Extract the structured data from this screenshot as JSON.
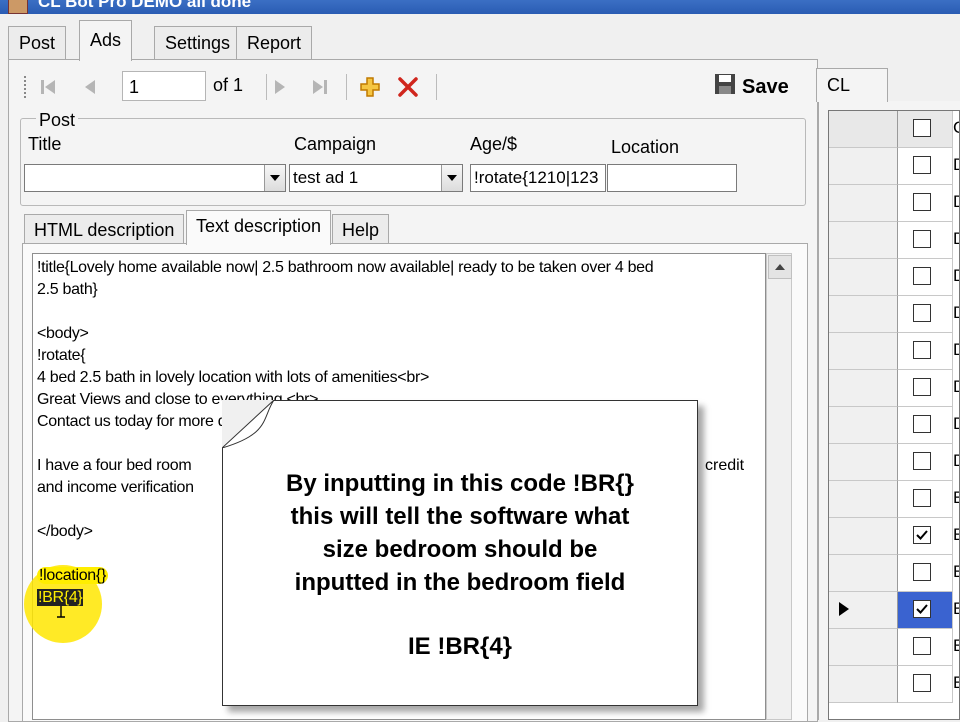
{
  "window": {
    "title": "CL Bot Pro DEMO all done"
  },
  "main_tabs": [
    {
      "label": "Post",
      "active": false
    },
    {
      "label": "Ads",
      "active": true
    },
    {
      "label": "Settings",
      "active": false
    },
    {
      "label": "Report",
      "active": false
    }
  ],
  "toolbar": {
    "current_record": "1",
    "of_count": "of 1",
    "save_label": "Save",
    "icons": [
      "move-first-icon",
      "move-previous-icon",
      "move-next-icon",
      "move-last-icon",
      "add-icon",
      "delete-icon",
      "save-disk-icon"
    ]
  },
  "post_group": {
    "legend": "Post",
    "title_label": "Title",
    "title_value": "",
    "campaign_label": "Campaign",
    "campaign_value": "test ad 1",
    "age_label": "Age/$",
    "age_value": "!rotate{1210|123",
    "location_label": "Location",
    "location_value": ""
  },
  "desc_tabs": [
    {
      "label": "HTML description",
      "active": false
    },
    {
      "label": "Text description",
      "active": true
    },
    {
      "label": "Help",
      "active": false
    }
  ],
  "editor": {
    "lines": [
      "!title{Lovely home available now| 2.5 bathroom now available| ready to be taken over 4 bed",
      "2.5 bath}",
      "",
      "<body>",
      "!rotate{",
      "4 bed 2.5 bath in lovely location with lots of amenities<br>",
      "Great Views and close to everything <br>",
      "Contact us today for more d",
      "",
      "I have a four bed room",
      "and income verification",
      "",
      "</body>",
      "",
      "!location{}",
      "!BR{4}"
    ],
    "peek_right_line10": "credit"
  },
  "callout": {
    "message_lines": [
      "By inputting in this code !BR{}",
      "this will tell the software what",
      "size bedroom should be",
      "inputted in the bedroom field"
    ],
    "example": "IE !BR{4}"
  },
  "right_panel": {
    "tab_label": "CL",
    "rows": [
      {
        "checked": false,
        "text": "C",
        "current": false,
        "header": true
      },
      {
        "checked": false,
        "text": "D",
        "current": false
      },
      {
        "checked": false,
        "text": "D",
        "current": false
      },
      {
        "checked": false,
        "text": "D",
        "current": false
      },
      {
        "checked": false,
        "text": "D",
        "current": false
      },
      {
        "checked": false,
        "text": "D",
        "current": false
      },
      {
        "checked": false,
        "text": "D",
        "current": false
      },
      {
        "checked": false,
        "text": "D",
        "current": false
      },
      {
        "checked": false,
        "text": "D",
        "current": false
      },
      {
        "checked": false,
        "text": "D",
        "current": false
      },
      {
        "checked": false,
        "text": "E",
        "current": false
      },
      {
        "checked": true,
        "text": "E",
        "current": false
      },
      {
        "checked": false,
        "text": "E",
        "current": false
      },
      {
        "checked": true,
        "text": "E",
        "current": true
      },
      {
        "checked": false,
        "text": "E",
        "current": false
      },
      {
        "checked": false,
        "text": "E",
        "current": false
      }
    ]
  },
  "colors": {
    "titlebar": "#2a5cb3",
    "highlight": "#ffee00",
    "selected_row": "#3a63d0",
    "delete_red": "#d0261d",
    "add_orange": "#e8a21a"
  }
}
